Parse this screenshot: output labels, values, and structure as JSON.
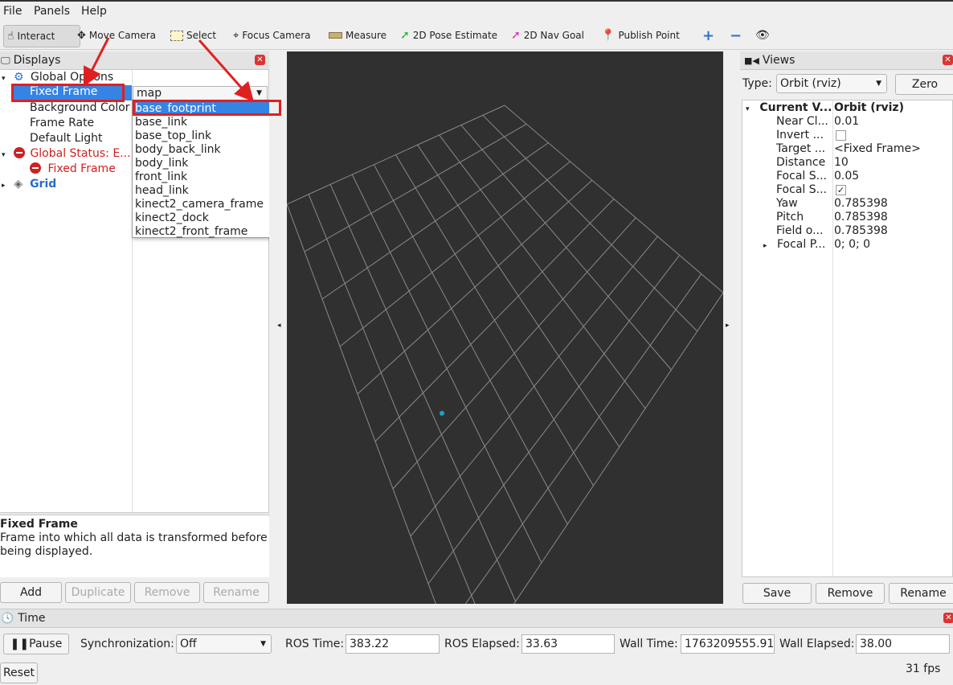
{
  "menu": {
    "file": "File",
    "panels": "Panels",
    "help": "Help"
  },
  "toolbar": {
    "interact": "Interact",
    "move_camera": "Move Camera",
    "select": "Select",
    "focus_camera": "Focus Camera",
    "measure": "Measure",
    "pose_estimate": "2D Pose Estimate",
    "nav_goal": "2D Nav Goal",
    "publish_point": "Publish Point"
  },
  "displays": {
    "title": "Displays",
    "global_options": "Global Options",
    "fixed_frame_label": "Fixed Frame",
    "fixed_frame_value": "map",
    "background_color": "Background Color",
    "frame_rate": "Frame Rate",
    "default_light": "Default Light",
    "global_status": "Global Status: E...",
    "status_fixed_frame": "Fixed Frame",
    "grid": "Grid",
    "dropdown_options": [
      "base_footprint",
      "base_link",
      "base_top_link",
      "body_back_link",
      "body_link",
      "front_link",
      "head_link",
      "kinect2_camera_frame",
      "kinect2_dock",
      "kinect2_front_frame"
    ],
    "dropdown_selected": "base_footprint",
    "help_title": "Fixed Frame",
    "help_text_line1": "Frame into which all data is transformed before",
    "help_text_line2": "being displayed.",
    "buttons": {
      "add": "Add",
      "duplicate": "Duplicate",
      "remove": "Remove",
      "rename": "Rename"
    }
  },
  "views": {
    "title": "Views",
    "type_label": "Type:",
    "type_value": "Orbit (rviz)",
    "zero": "Zero",
    "current_view_label": "Current V...",
    "current_view_value": "Orbit (rviz)",
    "props": [
      {
        "name": "Near Cl...",
        "value": "0.01"
      },
      {
        "name": "Invert ...",
        "value": ""
      },
      {
        "name": "Target ...",
        "value": "<Fixed Frame>"
      },
      {
        "name": "Distance",
        "value": "10"
      },
      {
        "name": "Focal S...",
        "value": "0.05"
      },
      {
        "name": "Focal S...",
        "value": ""
      },
      {
        "name": "Yaw",
        "value": "0.785398"
      },
      {
        "name": "Pitch",
        "value": "0.785398"
      },
      {
        "name": "Field o...",
        "value": "0.785398"
      },
      {
        "name": "Focal P...",
        "value": "0; 0; 0"
      }
    ],
    "invert_checked": false,
    "focal_shape_checked": true,
    "buttons": {
      "save": "Save",
      "remove": "Remove",
      "rename": "Rename"
    }
  },
  "time": {
    "title": "Time",
    "pause": "Pause",
    "sync_label": "Synchronization:",
    "sync_value": "Off",
    "ros_time_label": "ROS Time:",
    "ros_time": "383.22",
    "ros_elapsed_label": "ROS Elapsed:",
    "ros_elapsed": "33.63",
    "wall_time_label": "Wall Time:",
    "wall_time": "1763209555.91",
    "wall_elapsed_label": "Wall Elapsed:",
    "wall_elapsed": "38.00",
    "reset": "Reset",
    "fps": "31 fps"
  },
  "colors": {
    "viewport_bg": "#303030",
    "grid_line": "#8a8a8a",
    "selection": "#3584e4",
    "error_red": "#d02020",
    "annotation_red": "#e02020"
  }
}
